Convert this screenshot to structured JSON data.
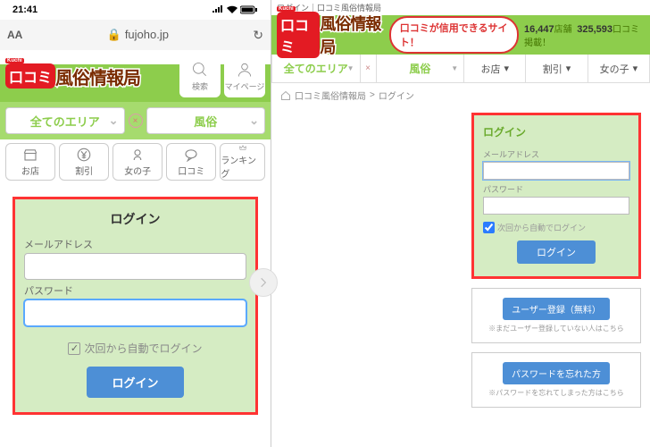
{
  "mobile": {
    "status_time": "21:41",
    "url_domain": "fujoho.jp",
    "logo_small": "Kuchi",
    "logo_badge": "口コミ",
    "logo_text": "風俗情報局",
    "search_label": "検索",
    "mypage_label": "マイページ",
    "area_dd": "全てのエリア",
    "genre_dd": "風俗",
    "cats": {
      "shop": "お店",
      "discount": "割引",
      "girls": "女の子",
      "review": "口コミ",
      "ranking": "ランキング"
    },
    "login": {
      "title": "ログイン",
      "email_label": "メールアドレス",
      "password_label": "パスワード",
      "auto_label": "次回から自動でログイン",
      "submit": "ログイン"
    }
  },
  "desktop": {
    "top_crumb": "ログイン｜口コミ風俗情報局",
    "pill": "口コミが信用できるサイト！",
    "stats_shops_n": "16,447",
    "stats_shops_l": "店舗",
    "stats_reviews_n": "325,593",
    "stats_reviews_l": "口コミ掲載！",
    "nav": {
      "area": "全てのエリア",
      "genre": "風俗",
      "shop": "お店",
      "discount": "割引",
      "girls": "女の子"
    },
    "breadcrumb": {
      "home": "口コミ風俗情報局",
      "current": "ログイン"
    },
    "login": {
      "title": "ログイン",
      "email_label": "メールアドレス",
      "password_label": "パスワード",
      "auto_label": "次回から自動でログイン",
      "submit": "ログイン"
    },
    "register": {
      "btn": "ユーザー登録（無料）",
      "note": "※まだユーザー登録していない人はこちら"
    },
    "forgot": {
      "btn": "パスワードを忘れた方",
      "note": "※パスワードを忘れてしまった方はこちら"
    }
  }
}
